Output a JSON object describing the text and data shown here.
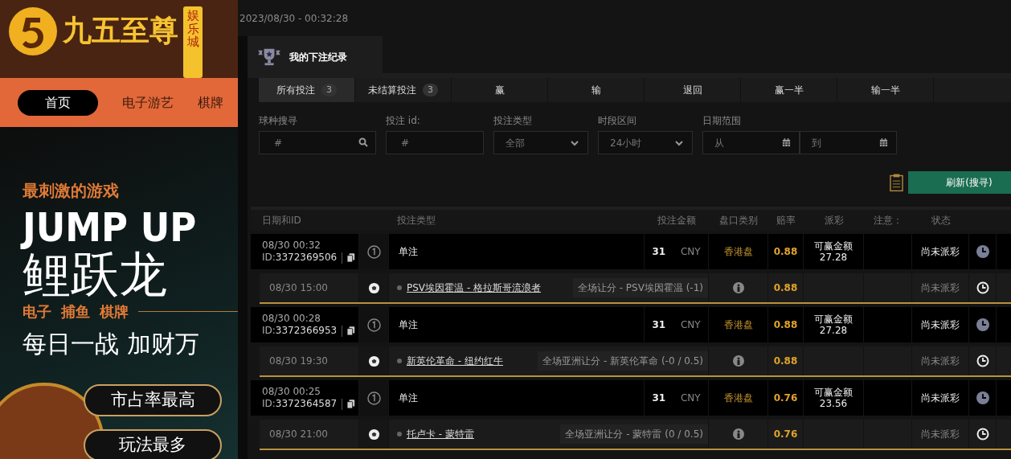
{
  "site": {
    "logo_text": "九五至尊",
    "logo_badge": "娱乐城",
    "nav": [
      {
        "label": "首页",
        "selected": true
      },
      {
        "label": "电子游艺",
        "selected": false
      },
      {
        "label": "棋牌",
        "selected": false
      }
    ],
    "banner": {
      "tagline": "最刺激的游戏",
      "headline": "JUMP UP",
      "title": "鲤跃龙",
      "categories": [
        "电子",
        "捕鱼",
        "棋牌"
      ],
      "slogan": "每日一战 加财万",
      "badges": [
        "市占率最高",
        "玩法最多"
      ]
    }
  },
  "timestamp": "2023/08/30 - 00:32:28",
  "modal": {
    "title": "我的下注纪录",
    "tabs": [
      {
        "label": "所有投注",
        "count": "3",
        "selected": true
      },
      {
        "label": "未结算投注",
        "count": "3",
        "selected": false
      },
      {
        "label": "赢",
        "selected": false
      },
      {
        "label": "输",
        "selected": false
      },
      {
        "label": "退回",
        "selected": false
      },
      {
        "label": "赢一半",
        "selected": false
      },
      {
        "label": "输一半",
        "selected": false
      }
    ],
    "filters": [
      {
        "kind": "search",
        "label": "球种搜寻",
        "placeholder": "#"
      },
      {
        "kind": "text",
        "label": "投注 id:",
        "placeholder": "#"
      },
      {
        "kind": "select",
        "label": "投注类型",
        "value": "全部"
      },
      {
        "kind": "select",
        "label": "时段区间",
        "value": "24小时"
      },
      {
        "kind": "daterange",
        "label": "日期范围",
        "from": "从",
        "to": "到"
      }
    ],
    "refresh_button": "刷新(搜寻)",
    "columns": [
      "日期和ID",
      "投注类型",
      "投注金额",
      "盘口类别",
      "赔率",
      "派彩",
      "注意：",
      "状态"
    ],
    "bets": [
      {
        "datetime": "08/30 00:32",
        "id_label": "ID:",
        "id": "3372369506",
        "type": "单注",
        "amount": "31",
        "currency": "CNY",
        "market": "香港盘",
        "odds": "0.88",
        "payout_label": "可赢金额",
        "payout": "27.28",
        "status": "尚未派彩",
        "selection": {
          "time": "08/30 15:00",
          "match": "PSV埃因霍温 - 格拉斯哥流浪者",
          "market_text": "全场让分 - PSV埃因霍温 (-1)",
          "odds": "0.88",
          "status": "尚未派彩"
        }
      },
      {
        "datetime": "08/30 00:28",
        "id_label": "ID:",
        "id": "3372366953",
        "type": "单注",
        "amount": "31",
        "currency": "CNY",
        "market": "香港盘",
        "odds": "0.88",
        "payout_label": "可赢金额",
        "payout": "27.28",
        "status": "尚未派彩",
        "selection": {
          "time": "08/30 19:30",
          "match": "新英伦革命 - 纽约红牛",
          "market_text": "全场亚洲让分 - 新英伦革命 (-0 / 0.5)",
          "odds": "0.88",
          "status": "尚未派彩"
        }
      },
      {
        "datetime": "08/30 00:25",
        "id_label": "ID:",
        "id": "3372364587",
        "type": "单注",
        "amount": "31",
        "currency": "CNY",
        "market": "香港盘",
        "odds": "0.76",
        "payout_label": "可赢金额",
        "payout": "23.56",
        "status": "尚未派彩",
        "selection": {
          "time": "08/30 21:00",
          "match": "托卢卡 - 蒙特雷",
          "market_text": "全场亚洲让分 - 蒙特雷 (0 / 0.5)",
          "odds": "0.76",
          "status": "尚未派彩"
        }
      }
    ]
  }
}
